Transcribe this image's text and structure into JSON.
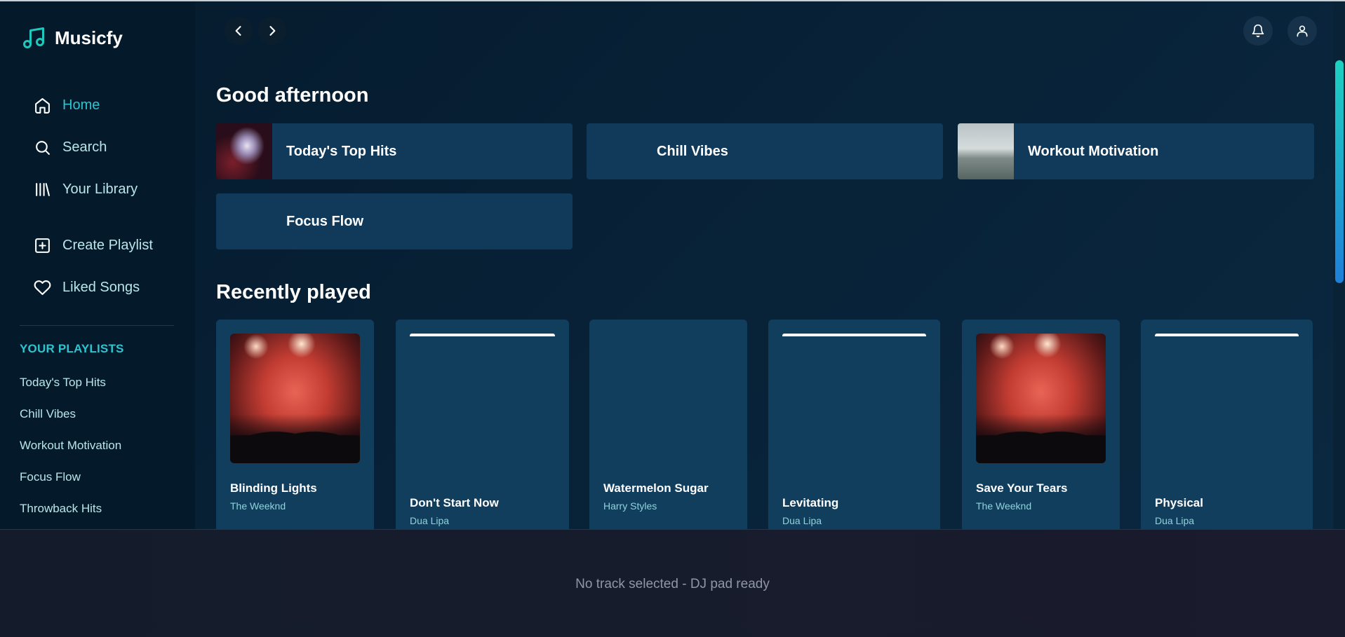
{
  "app": {
    "name": "Musicfy"
  },
  "sidebar": {
    "nav": [
      {
        "label": "Home",
        "icon": "home-icon",
        "active": true
      },
      {
        "label": "Search",
        "icon": "search-icon"
      },
      {
        "label": "Your Library",
        "icon": "library-icon"
      }
    ],
    "actions": [
      {
        "label": "Create Playlist",
        "icon": "plus-square-icon"
      },
      {
        "label": "Liked Songs",
        "icon": "heart-icon"
      }
    ],
    "playlists_heading": "YOUR PLAYLISTS",
    "playlists": [
      "Today's Top Hits",
      "Chill Vibes",
      "Workout Motivation",
      "Focus Flow",
      "Throwback Hits"
    ]
  },
  "main": {
    "greeting": "Good afternoon",
    "quick_picks": [
      {
        "label": "Today's Top Hits",
        "thumb": "concert"
      },
      {
        "label": "Chill Vibes",
        "thumb": "none"
      },
      {
        "label": "Workout Motivation",
        "thumb": "beach"
      },
      {
        "label": "Focus Flow",
        "thumb": "none"
      }
    ],
    "recently_played_title": "Recently played",
    "recently_played": [
      {
        "title": "Blinding Lights",
        "artist": "The Weeknd",
        "art": "concert"
      },
      {
        "title": "Don't Start Now",
        "artist": "Dua Lipa",
        "art": "bar"
      },
      {
        "title": "Watermelon Sugar",
        "artist": "Harry Styles",
        "art": "none"
      },
      {
        "title": "Levitating",
        "artist": "Dua Lipa",
        "art": "bar"
      },
      {
        "title": "Save Your Tears",
        "artist": "The Weeknd",
        "art": "concert"
      },
      {
        "title": "Physical",
        "artist": "Dua Lipa",
        "art": "bar"
      }
    ]
  },
  "player": {
    "status": "No track selected - DJ pad ready"
  },
  "colors": {
    "accent": "#2ec4cf",
    "card": "#123e5e",
    "sidebar": "#041a2a"
  }
}
